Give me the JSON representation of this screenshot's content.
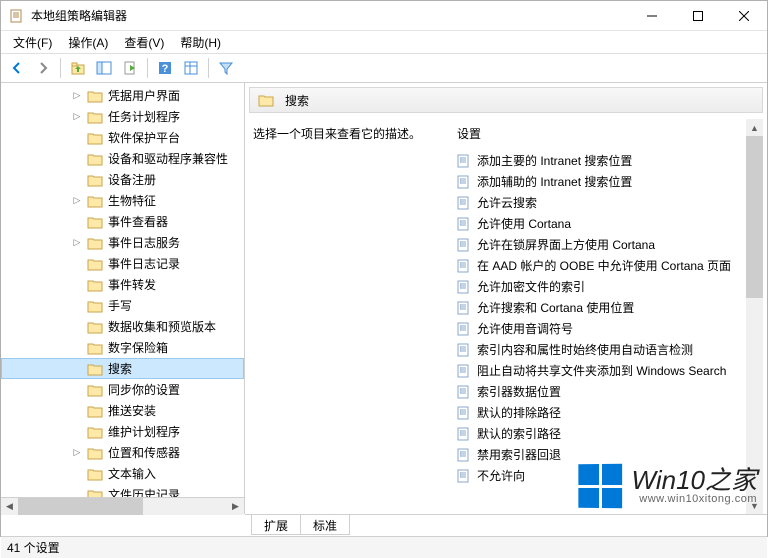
{
  "window": {
    "title": "本地组策略编辑器"
  },
  "menu": {
    "file": "文件(F)",
    "action": "操作(A)",
    "view": "查看(V)",
    "help": "帮助(H)"
  },
  "tree": [
    {
      "label": "凭据用户界面",
      "expandable": true
    },
    {
      "label": "任务计划程序",
      "expandable": true
    },
    {
      "label": "软件保护平台",
      "expandable": false
    },
    {
      "label": "设备和驱动程序兼容性",
      "expandable": false
    },
    {
      "label": "设备注册",
      "expandable": false
    },
    {
      "label": "生物特征",
      "expandable": true
    },
    {
      "label": "事件查看器",
      "expandable": false
    },
    {
      "label": "事件日志服务",
      "expandable": true
    },
    {
      "label": "事件日志记录",
      "expandable": false
    },
    {
      "label": "事件转发",
      "expandable": false
    },
    {
      "label": "手写",
      "expandable": false
    },
    {
      "label": "数据收集和预览版本",
      "expandable": false
    },
    {
      "label": "数字保险箱",
      "expandable": false
    },
    {
      "label": "搜索",
      "expandable": false,
      "selected": true
    },
    {
      "label": "同步你的设置",
      "expandable": false
    },
    {
      "label": "推送安装",
      "expandable": false
    },
    {
      "label": "维护计划程序",
      "expandable": false
    },
    {
      "label": "位置和传感器",
      "expandable": true
    },
    {
      "label": "文本输入",
      "expandable": false
    },
    {
      "label": "文件历史记录",
      "expandable": false
    }
  ],
  "header": {
    "title": "搜索"
  },
  "description": {
    "text": "选择一个项目来查看它的描述。"
  },
  "settings_header": "设置",
  "settings": [
    "添加主要的 Intranet 搜索位置",
    "添加辅助的 Intranet 搜索位置",
    "允许云搜索",
    "允许使用 Cortana",
    "允许在锁屏界面上方使用 Cortana",
    "在 AAD 帐户的 OOBE 中允许使用 Cortana 页面",
    "允许加密文件的索引",
    "允许搜索和 Cortana 使用位置",
    "允许使用音调符号",
    "索引内容和属性时始终使用自动语言检测",
    "阻止自动将共享文件夹添加到 Windows Search",
    "索引器数据位置",
    "默认的排除路径",
    "默认的索引路径",
    "禁用索引器回退",
    "不允许向"
  ],
  "tabs": {
    "extended": "扩展",
    "standard": "标准"
  },
  "status": "41 个设置",
  "watermark": {
    "main": "Win10之家",
    "sub": "www.win10xitong.com"
  }
}
